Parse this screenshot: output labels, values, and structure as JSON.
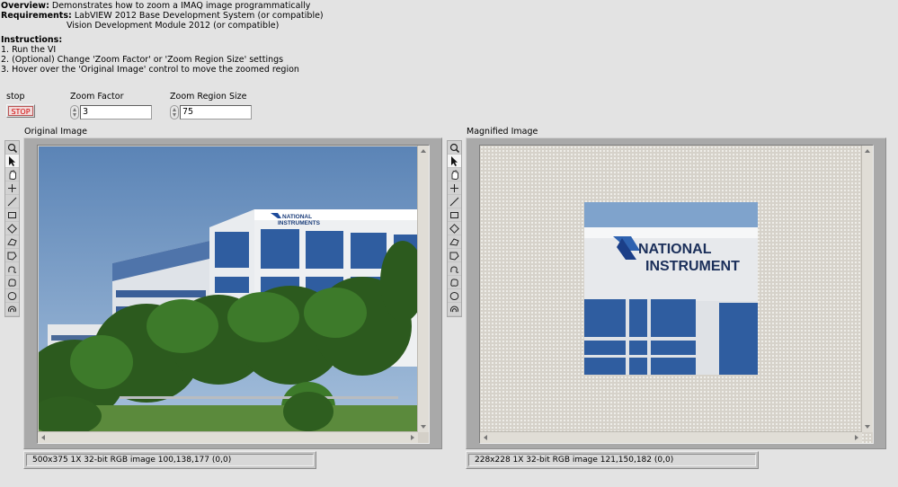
{
  "doc": {
    "overview_label": "Overview:",
    "overview_text": " Demonstrates how to zoom a IMAQ image programmatically",
    "requirements_label": "Requirements:",
    "requirements_line1": " LabVIEW 2012 Base Development System (or compatible)",
    "requirements_line2": "Vision Development Module 2012 (or compatible)",
    "instructions_label": "Instructions:",
    "steps": [
      "1. Run the VI",
      "2. (Optional) Change 'Zoom Factor' or 'Zoom Region Size' settings",
      "3. Hover over the 'Original Image' control to move the zoomed region"
    ]
  },
  "controls": {
    "stop_label": "stop",
    "stop_button": "STOP",
    "zoom_factor_label": "Zoom Factor",
    "zoom_factor_value": "3",
    "zoom_region_label": "Zoom Region Size",
    "zoom_region_value": "75"
  },
  "original": {
    "label": "Original Image",
    "status": "500x375 1X 32-bit RGB image 100,138,177     (0,0)",
    "sign_line1": "NATIONAL",
    "sign_line2": "INSTRUMENTS"
  },
  "magnified": {
    "label": "Magnified Image",
    "status": "228x228 1X 32-bit RGB image 121,150,182     (0,0)",
    "sign_line1": "NATIONAL",
    "sign_line2": "INSTRUMENT"
  },
  "tools": [
    "zoom-icon",
    "pointer-icon",
    "pan-icon",
    "crosshair-icon",
    "line-icon",
    "rectangle-icon",
    "rotated-rect-icon",
    "annulus-icon",
    "polygon-icon",
    "freehand-icon",
    "freehand-region-icon",
    "oval-icon",
    "annulus-arc-icon"
  ],
  "colors": {
    "background": "#e3e3e3",
    "stop_text": "#d00000",
    "sky": "#6f95c0",
    "glass": "#2f5da0"
  }
}
